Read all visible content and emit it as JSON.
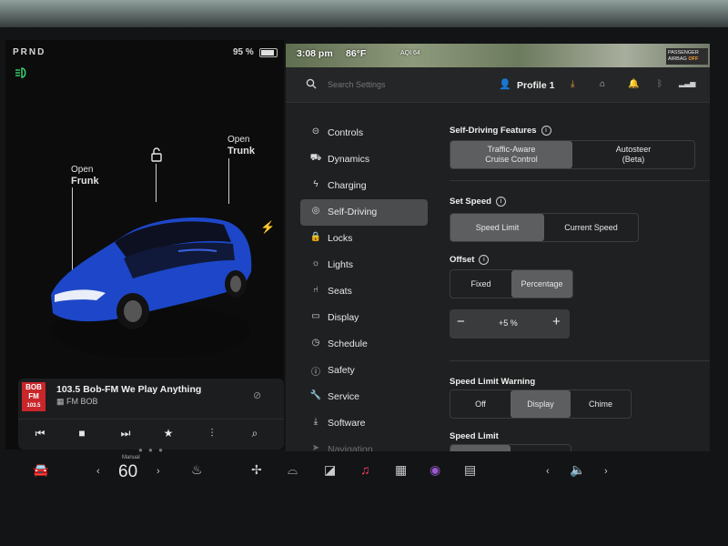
{
  "left": {
    "gear": "PRND",
    "battery": "95 %",
    "battery_level": 0.95,
    "frunk_line1": "Open",
    "frunk_line2": "Frunk",
    "trunk_line1": "Open",
    "trunk_line2": "Trunk",
    "car_color": "#1d47c8",
    "headlight_color": "#37d26b"
  },
  "media": {
    "logo_line1": "BOB",
    "logo_line2": "FM",
    "logo_line3": "103.5",
    "title": "103.5 Bob-FM We Play Anything",
    "source": "FM BOB",
    "controls": [
      "previous-icon",
      "stop-icon",
      "next-icon",
      "favorite-icon",
      "equalizer-icon",
      "search-icon"
    ]
  },
  "status": {
    "time": "3:08 pm",
    "temp": "86°F",
    "aqi": "AQI 64",
    "airbag_line1": "PASSENGER",
    "airbag_line2": "AIRBAG",
    "airbag_state": "OFF"
  },
  "topbar": {
    "search_placeholder": "Search Settings",
    "profile": "Profile 1"
  },
  "menu": [
    {
      "icon": "toggle-icon",
      "label": "Controls"
    },
    {
      "icon": "car-icon",
      "label": "Dynamics"
    },
    {
      "icon": "bolt-icon",
      "label": "Charging"
    },
    {
      "icon": "steering-wheel-icon",
      "label": "Self-Driving",
      "active": true
    },
    {
      "icon": "lock-icon",
      "label": "Locks"
    },
    {
      "icon": "sun-icon",
      "label": "Lights"
    },
    {
      "icon": "seat-icon",
      "label": "Seats"
    },
    {
      "icon": "display-icon",
      "label": "Display"
    },
    {
      "icon": "clock-icon",
      "label": "Schedule"
    },
    {
      "icon": "safety-icon",
      "label": "Safety"
    },
    {
      "icon": "wrench-icon",
      "label": "Service"
    },
    {
      "icon": "download-icon",
      "label": "Software"
    },
    {
      "icon": "navigation-icon",
      "label": "Navigation"
    }
  ],
  "settings": {
    "features_title": "Self-Driving Features",
    "features_opt1_l1": "Traffic-Aware",
    "features_opt1_l2": "Cruise Control",
    "features_opt2_l1": "Autosteer",
    "features_opt2_l2": "(Beta)",
    "speed_title": "Set Speed",
    "speed_opt1": "Speed Limit",
    "speed_opt2": "Current Speed",
    "offset_title": "Offset",
    "offset_opt1": "Fixed",
    "offset_opt2": "Percentage",
    "offset_value": "+5 %",
    "warning_title": "Speed Limit Warning",
    "warning_opt1": "Off",
    "warning_opt2": "Display",
    "warning_opt3": "Chime",
    "limit_title": "Speed Limit"
  },
  "dock": {
    "temp_label": "Manual",
    "temp_value": "60"
  }
}
